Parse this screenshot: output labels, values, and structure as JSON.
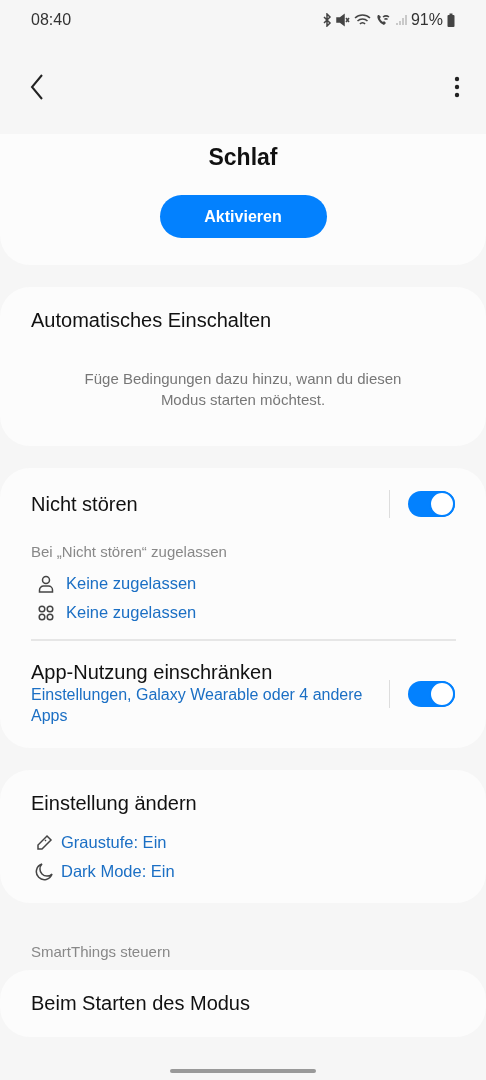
{
  "status_bar": {
    "time": "08:40",
    "battery": "91%"
  },
  "mode": {
    "title": "Schlaf",
    "button": "Aktivieren"
  },
  "automatic": {
    "title": "Automatisches Einschalten",
    "description": "Füge Bedingungen dazu hinzu, wann du diesen Modus starten möchtest."
  },
  "do_not_disturb": {
    "title": "Nicht stören",
    "on": true,
    "allowed_label": "Bei „Nicht stören“ zugelassen",
    "exceptions": [
      {
        "kind": "people",
        "text": "Keine zugelassen"
      },
      {
        "kind": "apps",
        "text": "Keine zugelassen"
      }
    ]
  },
  "app_usage": {
    "title": "App-Nutzung einschränken",
    "subtitle": "Einstellungen, Galaxy Wearable oder 4 andere Apps",
    "on": true
  },
  "change_settings": {
    "title": "Einstellung ändern",
    "items": [
      {
        "kind": "grayscale",
        "text": "Graustufe: Ein"
      },
      {
        "kind": "dark_mode",
        "text": "Dark Mode: Ein"
      }
    ]
  },
  "section_header": "SmartThings steuern",
  "next_card": {
    "title": "Beim Starten des Modus"
  }
}
